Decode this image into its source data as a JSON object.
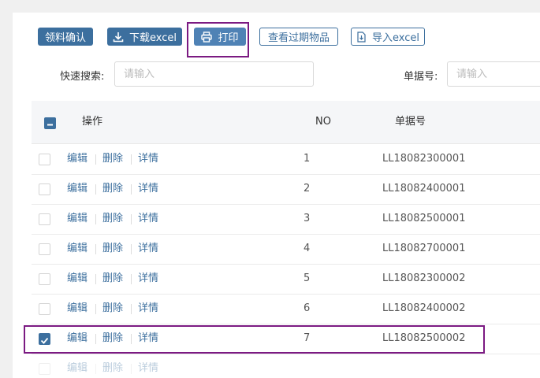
{
  "toolbar": {
    "confirm_label": "领料确认",
    "download_label": "下载excel",
    "print_label": "打印",
    "expired_label": "查看过期物品",
    "import_label": "导入excel"
  },
  "search": {
    "quick_label": "快速搜索:",
    "quick_placeholder": "请输入",
    "docno_label": "单据号:",
    "docno_placeholder": "请输入"
  },
  "table": {
    "headers": {
      "ops": "操作",
      "no": "NO",
      "docno": "单据号"
    },
    "ops": {
      "edit": "编辑",
      "delete": "删除",
      "detail": "详情"
    },
    "rows": [
      {
        "no": "1",
        "docno": "LL18082300001",
        "checked": false
      },
      {
        "no": "2",
        "docno": "LL18082400001",
        "checked": false
      },
      {
        "no": "3",
        "docno": "LL18082500001",
        "checked": false
      },
      {
        "no": "4",
        "docno": "LL18082700001",
        "checked": false
      },
      {
        "no": "5",
        "docno": "LL18082300002",
        "checked": false
      },
      {
        "no": "6",
        "docno": "LL18082400002",
        "checked": false
      },
      {
        "no": "7",
        "docno": "LL18082500002",
        "checked": true
      }
    ]
  },
  "colors": {
    "accent": "#3c6f9e",
    "highlight": "#7b1a82"
  }
}
